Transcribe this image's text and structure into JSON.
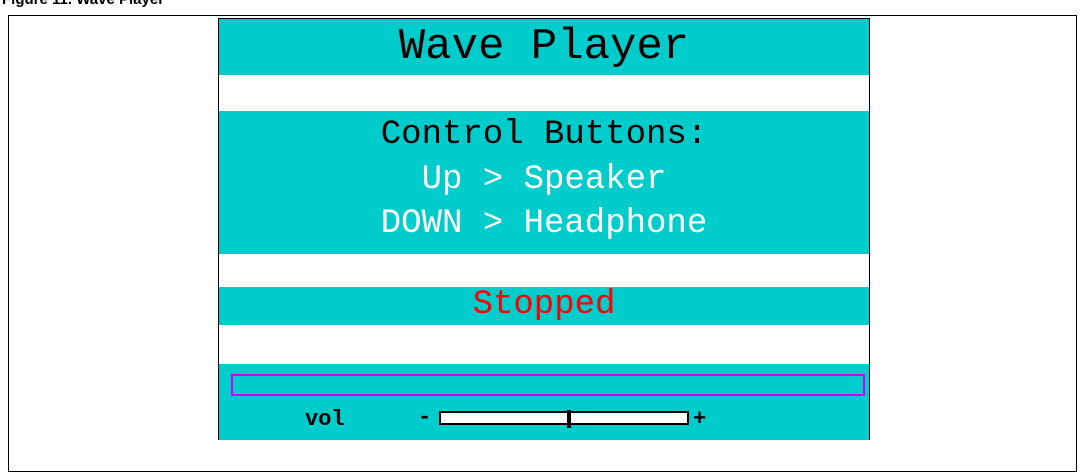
{
  "caption": "Figure 11. Wave Player",
  "player": {
    "title": "Wave Player",
    "controls": {
      "heading": "Control Buttons:",
      "lines": [
        "Up > Speaker",
        "DOWN > Headphone"
      ]
    },
    "status": "Stopped",
    "progress": 0,
    "volume": {
      "label": "vol",
      "minus": "-",
      "plus": "+",
      "level": 0.52
    }
  },
  "colors": {
    "band": "#00CCCC",
    "status_text": "#FF0000",
    "progress_border": "#CC00FF",
    "control_lines": "#FFFFFF"
  }
}
